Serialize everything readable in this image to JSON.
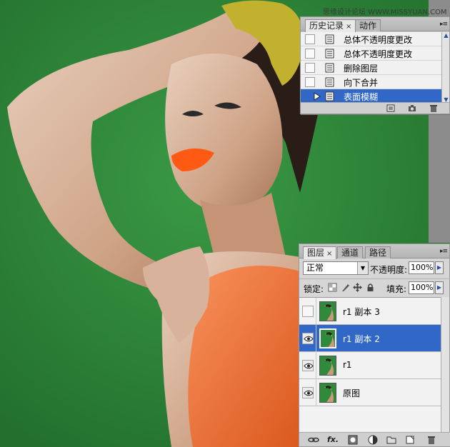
{
  "watermark": "思缘设计论坛 WWW.MISSYUAN.COM",
  "history_panel": {
    "tabs": [
      {
        "label": "历史记录",
        "close": "×",
        "active": true
      },
      {
        "label": "动作",
        "active": false
      }
    ],
    "menu_glyph": "▸≡",
    "items": [
      {
        "label": "总体不透明度更改",
        "selected": false
      },
      {
        "label": "总体不透明度更改",
        "selected": false
      },
      {
        "label": "删除图层",
        "selected": false
      },
      {
        "label": "向下合并",
        "selected": false
      },
      {
        "label": "表面模糊",
        "selected": true
      }
    ],
    "footer_icons": [
      "new-document-from-state-icon",
      "new-snapshot-icon",
      "trash-icon"
    ]
  },
  "layers_panel": {
    "tabs": [
      {
        "label": "图层",
        "close": "×",
        "active": true
      },
      {
        "label": "通道",
        "active": false
      },
      {
        "label": "路径",
        "active": false
      }
    ],
    "menu_glyph": "▸≡",
    "blend_mode": "正常",
    "opacity_label": "不透明度:",
    "opacity_value": "100%",
    "lock_label": "锁定:",
    "fill_label": "填充:",
    "fill_value": "100%",
    "layers": [
      {
        "name": "r1 副本 3",
        "visible": false,
        "selected": false
      },
      {
        "name": "r1 副本 2",
        "visible": true,
        "selected": true
      },
      {
        "name": "r1",
        "visible": true,
        "selected": false
      },
      {
        "name": "原图",
        "visible": true,
        "selected": false
      }
    ],
    "footer_icons": [
      "link-layers-icon",
      "layer-style-icon",
      "add-mask-icon",
      "adjustment-layer-icon",
      "new-group-icon",
      "new-layer-icon",
      "trash-icon"
    ],
    "fx_label": "fx."
  },
  "colors": {
    "canvas_bg": "#2f8a3c",
    "selection": "#3168c8",
    "panel_bg": "#d6d6d6",
    "lips": "#ff5a14",
    "top": "#f07b3a",
    "glove": "#c2b12e"
  }
}
